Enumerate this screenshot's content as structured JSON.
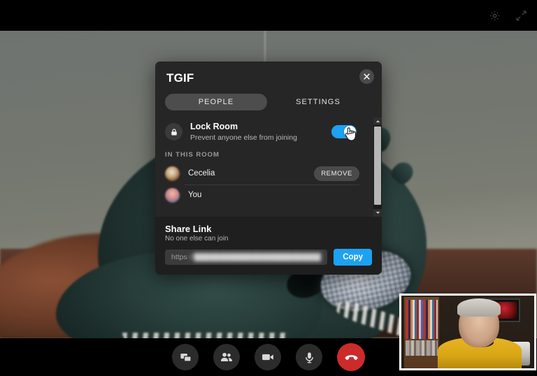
{
  "window": {
    "top_icons": [
      {
        "name": "settings-gear-icon",
        "label": "Settings"
      },
      {
        "name": "fullscreen-icon",
        "label": "Fullscreen"
      }
    ]
  },
  "dialog": {
    "title": "TGIF",
    "close_label": "✕",
    "tabs": [
      {
        "label": "PEOPLE",
        "active": true
      },
      {
        "label": "SETTINGS",
        "active": false
      }
    ],
    "lock_room": {
      "title": "Lock Room",
      "subtitle": "Prevent anyone else from joining",
      "icon": "lock-icon",
      "toggle_on": true,
      "toggle_color": "#1da1f2"
    },
    "section_label": "IN THIS ROOM",
    "participants": [
      {
        "name": "Cecelia",
        "action_label": "REMOVE",
        "has_action": true
      },
      {
        "name": "You",
        "action_label": "",
        "has_action": false
      }
    ],
    "share": {
      "title": "Share Link",
      "subtitle": "No one else can join",
      "link_protocol": "https",
      "link_redacted": "://████████████████████████████",
      "copy_label": "Copy",
      "copy_color": "#1da1f2"
    }
  },
  "toolbar": {
    "buttons": [
      {
        "name": "screen-share-button",
        "icon": "screens-icon",
        "label": "Share screen"
      },
      {
        "name": "people-button",
        "icon": "people-icon",
        "label": "People"
      },
      {
        "name": "camera-button",
        "icon": "video-camera-icon",
        "label": "Camera"
      },
      {
        "name": "microphone-button",
        "icon": "microphone-icon",
        "label": "Microphone"
      },
      {
        "name": "hangup-button",
        "icon": "phone-hangup-icon",
        "label": "Leave call",
        "color": "#cc2b2b"
      }
    ]
  },
  "self_view": {
    "label": "Self view"
  }
}
